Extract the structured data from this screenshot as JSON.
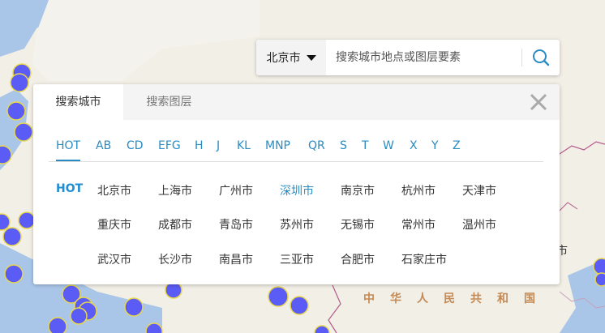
{
  "search": {
    "city": "北京市",
    "placeholder": "搜索城市地点或图层要素"
  },
  "panel": {
    "tabs": [
      "搜索城市",
      "搜索图层"
    ],
    "letters": [
      "HOT",
      "AB",
      "CD",
      "EFG",
      "H",
      "J",
      "KL",
      "MNP",
      "QR",
      "S",
      "T",
      "W",
      "X",
      "Y",
      "Z"
    ],
    "active_letter": "HOT",
    "hot_label": "HOT",
    "cities": [
      [
        "北京市",
        "上海市",
        "广州市",
        "深圳市",
        "南京市",
        "杭州市",
        "天津市"
      ],
      [
        "重庆市",
        "成都市",
        "青岛市",
        "苏州市",
        "无锡市",
        "常州市",
        "温州市"
      ],
      [
        "武汉市",
        "长沙市",
        "南昌市",
        "三亚市",
        "合肥市",
        "石家庄市"
      ]
    ],
    "highlighted_city": "深圳市"
  },
  "map": {
    "country_label": "中华人民共和国",
    "fragment_label": "市"
  },
  "colors": {
    "accent": "#2a8bc2",
    "hot": "#1f8ed2",
    "marker_fill": "#5b5bf5",
    "marker_stroke": "#e8d84a",
    "water": "#a9c6e8",
    "land": "#f2efe6",
    "border": "#b35a8a"
  },
  "icons": {
    "search": "search-icon",
    "close": "close-icon",
    "caret": "caret-down-icon"
  }
}
